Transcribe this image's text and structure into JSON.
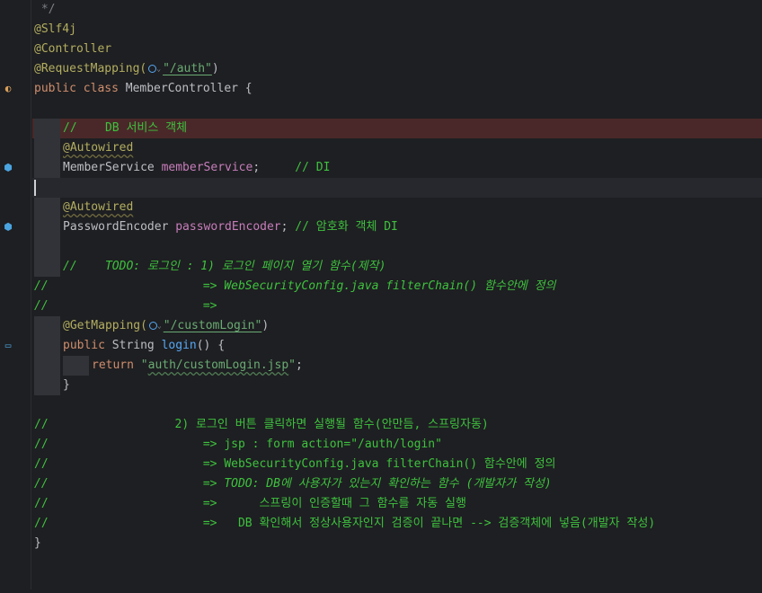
{
  "gutter_icons": {
    "class_icon": "spring-bean-class-icon",
    "bean_icon_1": "autowired-bean-icon",
    "bean_icon_2": "autowired-bean-icon",
    "mapping_icon": "request-mapping-icon"
  },
  "colors": {
    "background": "#1e1f22",
    "keyword": "#cf8e6d",
    "annotation": "#b3ae60",
    "string": "#6aab73",
    "field": "#c77dbb",
    "method": "#56a8f5",
    "comment": "#3ec23e",
    "error_highlight": "#4a2829"
  },
  "code": {
    "l1": " */",
    "l2": "@Slf4j",
    "l3": "@Controller",
    "l4_ann": "@RequestMapping(",
    "l4_str": "\"/auth\"",
    "l4_end": ")",
    "l5_kw": "public class ",
    "l5_name": "MemberController {",
    "l7_cmt": "//    DB 서비스 객체",
    "l8_ann": "@Autowired",
    "l9_type": "MemberService ",
    "l9_field": "memberService",
    "l9_semi": ";",
    "l9_cmt": "     // DI",
    "l11_ann": "@Autowired",
    "l12_type": "PasswordEncoder ",
    "l12_field": "passwordEncoder",
    "l12_semi": "; ",
    "l12_cmt": "// 암호화 객체 DI",
    "l14_cmt": "//    TODO: 로그인 : 1) 로그인 페이지 열기 함수(제작)",
    "l15_cmt": "//                      => WebSecurityConfig.java filterChain() 함수안에 정의",
    "l16_cmt": "//                      =>",
    "l17_ann": "@GetMapping(",
    "l17_str": "\"/customLogin\"",
    "l17_end": ")",
    "l18_kw": "public ",
    "l18_type": "String ",
    "l18_method": "login",
    "l18_end": "() {",
    "l19_kw": "return ",
    "l19_str": "\"auth/customLogin.jsp\"",
    "l19_end": ";",
    "l20": "}",
    "l22_cmt": "//                  2) 로그인 버튼 클릭하면 실행될 함수(안만듬, 스프링자동)",
    "l23_cmt": "//                      => jsp : form action=\"/auth/login\"",
    "l24_cmt": "//                      => WebSecurityConfig.java filterChain() 함수안에 정의",
    "l25_cmt": "//                      => TODO: DB에 사용자가 있는지 확인하는 함수 (개발자가 작성)",
    "l26_cmt": "//                      =>      스프링이 인증할때 그 함수를 자동 실행",
    "l27_cmt": "//                      =>   DB 확인해서 정상사용자인지 검증이 끝나면 --> 검증객체에 넣음(개발자 작성)",
    "l28": "}"
  }
}
